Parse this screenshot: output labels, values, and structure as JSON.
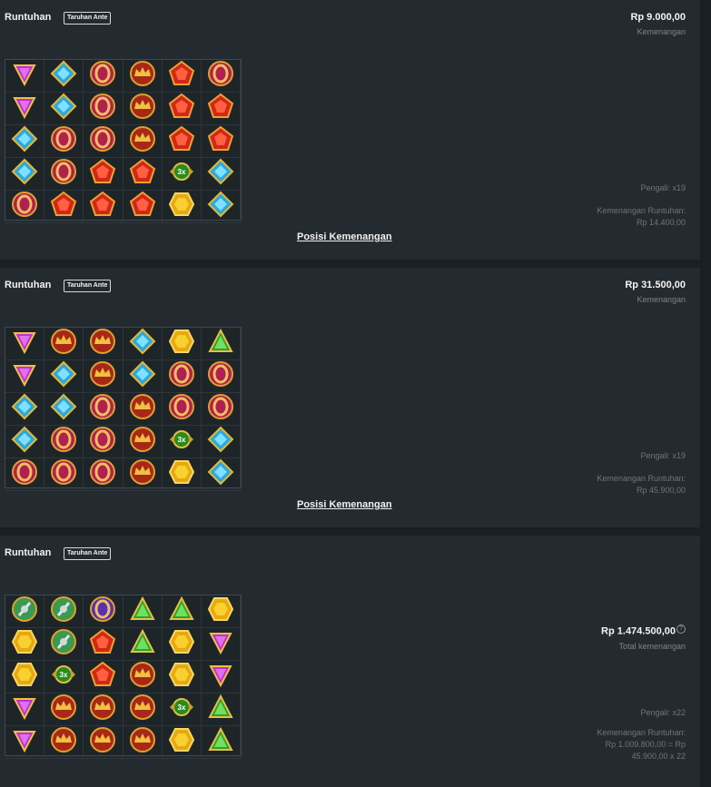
{
  "rounds": [
    {
      "title": "Runtuhan",
      "badge": "Taruhan Ante",
      "amount": "Rp 9.000,00",
      "amount_label": "Kemenangan",
      "multiplier": "Pengali: x19",
      "cascade_label": "Kemenangan Runtuhan:",
      "cascade_value": "Rp 14.400,00",
      "link": "Posisi Kemenangan",
      "grid": [
        [
          "tri-purple",
          "diamond-blue",
          "ring-red",
          "crown-red",
          "penta-red",
          "ring-red"
        ],
        [
          "tri-purple",
          "diamond-blue",
          "ring-red",
          "crown-red",
          "penta-red",
          "penta-red"
        ],
        [
          "diamond-blue",
          "ring-red",
          "ring-red",
          "crown-red",
          "penta-red",
          "penta-red"
        ],
        [
          "diamond-blue",
          "ring-red",
          "penta-red",
          "penta-red",
          "mult-3x",
          "diamond-blue"
        ],
        [
          "ring-red",
          "penta-red",
          "penta-red",
          "penta-red",
          "hex-gold",
          "diamond-blue"
        ]
      ]
    },
    {
      "title": "Runtuhan",
      "badge": "Taruhan Ante",
      "amount": "Rp 31.500,00",
      "amount_label": "Kemenangan",
      "multiplier": "Pengali: x19",
      "cascade_label": "Kemenangan Runtuhan:",
      "cascade_value": "Rp 45.900,00",
      "link": "Posisi Kemenangan",
      "grid": [
        [
          "tri-purple",
          "crown-red",
          "crown-red",
          "diamond-blue",
          "hex-gold",
          "tri-green"
        ],
        [
          "tri-purple",
          "diamond-blue",
          "crown-red",
          "diamond-blue",
          "ring-red",
          "ring-red"
        ],
        [
          "diamond-blue",
          "diamond-blue",
          "ring-red",
          "crown-red",
          "ring-red",
          "ring-red"
        ],
        [
          "diamond-blue",
          "ring-red",
          "ring-red",
          "crown-red",
          "mult-3x",
          "diamond-blue"
        ],
        [
          "ring-red",
          "ring-red",
          "ring-red",
          "crown-red",
          "hex-gold",
          "diamond-blue"
        ]
      ]
    },
    {
      "title": "Runtuhan",
      "badge": "Taruhan Ante",
      "amount": "Rp 1.474.500,00",
      "amount_label": "Total kemenangan",
      "multiplier": "Pengali: x22",
      "cascade_label": "Kemenangan Runtuhan:",
      "cascade_value": "Rp 1.009.800,00 = Rp",
      "cascade_value2": "45.900,00 x 22",
      "grid": [
        [
          "scatter-green",
          "scatter-green",
          "ring-purple",
          "tri-green",
          "tri-green",
          "hex-gold"
        ],
        [
          "hex-gold",
          "scatter-green",
          "penta-red",
          "tri-green",
          "hex-gold",
          "tri-purple"
        ],
        [
          "hex-gold",
          "mult-3x",
          "penta-red",
          "crown-red",
          "hex-gold",
          "tri-purple"
        ],
        [
          "tri-purple",
          "crown-red",
          "crown-red",
          "crown-red",
          "mult-3x",
          "tri-green"
        ],
        [
          "tri-purple",
          "crown-red",
          "crown-red",
          "crown-red",
          "hex-gold",
          "tri-green"
        ]
      ]
    }
  ],
  "colors": {
    "background": "#1a1f23",
    "panel": "#242b30",
    "muted_text": "#7d858b"
  }
}
